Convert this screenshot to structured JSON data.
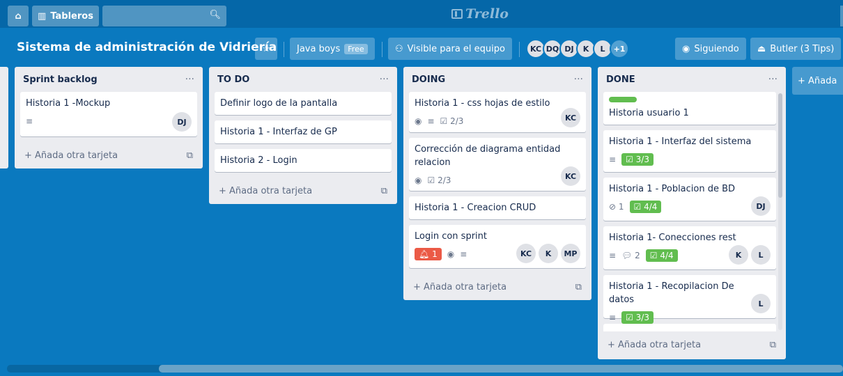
{
  "topbar": {
    "home_icon": "home-icon",
    "boards_label": "Tableros",
    "search_icon": "search-icon",
    "logo": "Trello"
  },
  "board": {
    "title": "Sistema de administración de Vidriería",
    "team": "Java boys",
    "team_badge": "Free",
    "visibility": "Visible para el equipo",
    "members": [
      "KC",
      "DQ",
      "DJ",
      "K",
      "L",
      "+1"
    ],
    "following": "Siguiendo",
    "butler": "Butler (3 Tips)"
  },
  "lists": [
    {
      "title": "Sprint backlog",
      "menu": "···",
      "add": "Añada otra tarjeta",
      "cards": [
        {
          "title": "Historia 1 -Mockup",
          "members": [
            "DJ"
          ]
        }
      ]
    },
    {
      "title": "TO DO",
      "menu": "···",
      "add": "Añada otra tarjeta",
      "cards": [
        {
          "title": "Definir logo de la pantalla"
        },
        {
          "title": "Historia 1 - Interfaz de GP"
        },
        {
          "title": "Historia 2 - Login"
        }
      ]
    },
    {
      "title": "DOING",
      "menu": "···",
      "add": "Añada otra tarjeta",
      "cards": [
        {
          "title": "Historia 1 - css hojas de estilo",
          "checklist": "2/3",
          "members": [
            "KC"
          ]
        },
        {
          "title": "Corrección de diagrama entidad relacion",
          "checklist": "2/3",
          "members": [
            "KC"
          ]
        },
        {
          "title": "Historia 1 - Creacion CRUD"
        },
        {
          "title": "Login con sprint",
          "alert": "1",
          "members": [
            "KC",
            "K",
            "MP"
          ]
        }
      ]
    },
    {
      "title": "DONE",
      "menu": "···",
      "add": "Añada otra tarjeta",
      "cards": [
        {
          "title": "Historia usuario 1"
        },
        {
          "title": "Historia 1 - Interfaz del sistema",
          "checklist": "3/3"
        },
        {
          "title": "Historia 1 - Poblacion de BD",
          "attachments": "1",
          "checklist": "4/4",
          "members": [
            "DJ"
          ]
        },
        {
          "title": "Historia 1- Conecciones rest",
          "comments": "2",
          "checklist": "4/4",
          "members": [
            "K",
            "L"
          ]
        },
        {
          "title": "Historia 1 - Recopilacion De datos",
          "checklist": "3/3",
          "members": [
            "L"
          ]
        }
      ]
    }
  ],
  "add_list": "Añada"
}
